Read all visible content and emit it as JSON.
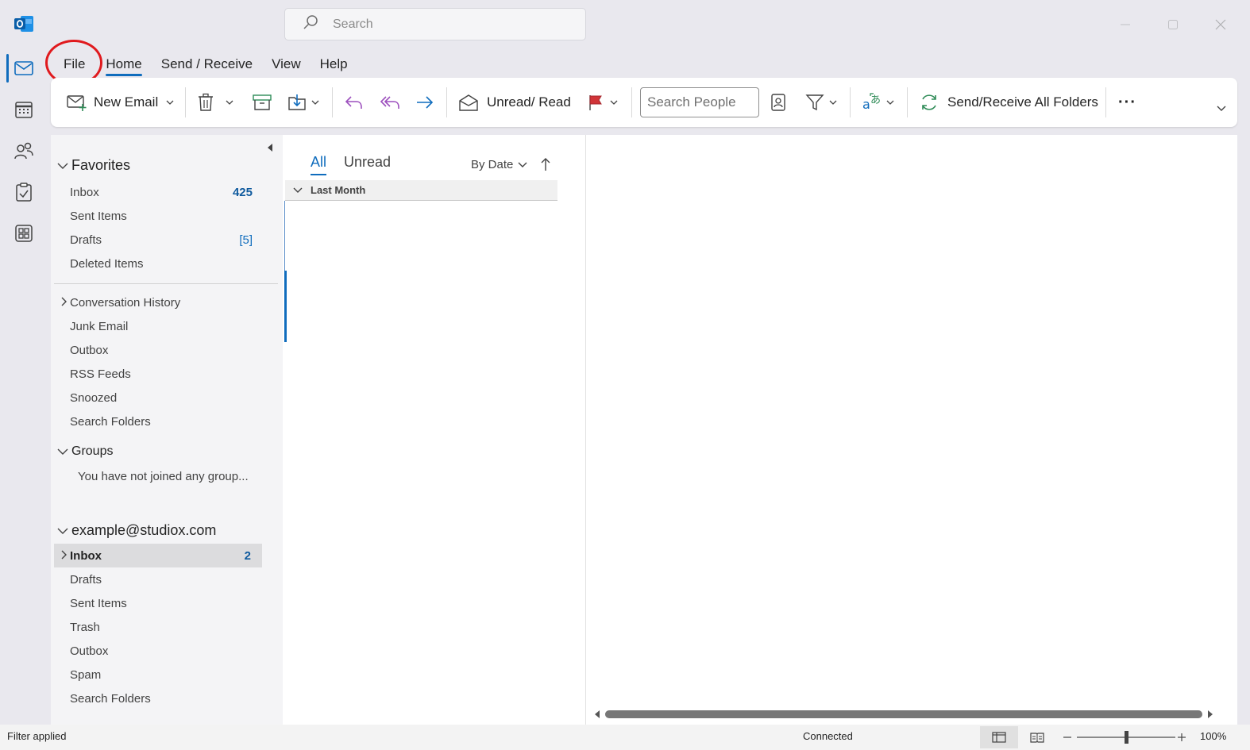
{
  "titlebar": {
    "search_placeholder": "Search"
  },
  "menu": {
    "tabs": [
      {
        "label": "File"
      },
      {
        "label": "Home"
      },
      {
        "label": "Send / Receive"
      },
      {
        "label": "View"
      },
      {
        "label": "Help"
      }
    ],
    "active": "Home",
    "highlighted": "File"
  },
  "ribbon": {
    "new_email": "New Email",
    "unread_read": "Unread/ Read",
    "search_people_placeholder": "Search People",
    "send_receive_all": "Send/Receive All Folders",
    "more": "···"
  },
  "folders": {
    "favorites_label": "Favorites",
    "favorites": [
      {
        "label": "Inbox",
        "count": "425"
      },
      {
        "label": "Sent Items",
        "count": ""
      },
      {
        "label": "Drafts",
        "count": "[5]"
      },
      {
        "label": "Deleted Items",
        "count": ""
      }
    ],
    "other": [
      {
        "label": "Conversation History"
      },
      {
        "label": "Junk Email"
      },
      {
        "label": "Outbox"
      },
      {
        "label": "RSS Feeds"
      },
      {
        "label": "Snoozed"
      },
      {
        "label": "Search Folders"
      }
    ],
    "groups_label": "Groups",
    "groups_message": "You have not joined any group...",
    "account_label": "example@studiox.com",
    "account": [
      {
        "label": "Inbox",
        "count": "2"
      },
      {
        "label": "Drafts",
        "count": ""
      },
      {
        "label": "Sent Items",
        "count": ""
      },
      {
        "label": "Trash",
        "count": ""
      },
      {
        "label": "Outbox",
        "count": ""
      },
      {
        "label": "Spam",
        "count": ""
      },
      {
        "label": "Search Folders",
        "count": ""
      }
    ]
  },
  "message_list": {
    "tab_all": "All",
    "tab_unread": "Unread",
    "sort_label": "By Date",
    "group_header": "Last Month"
  },
  "statusbar": {
    "filter": "Filter applied",
    "connection": "Connected",
    "zoom": "100%",
    "zoom_level_percent": 100
  },
  "colors": {
    "accent": "#0f6cbd",
    "highlight_circle": "#e0191d",
    "flag": "#d13438",
    "sync": "#2e8b57"
  }
}
